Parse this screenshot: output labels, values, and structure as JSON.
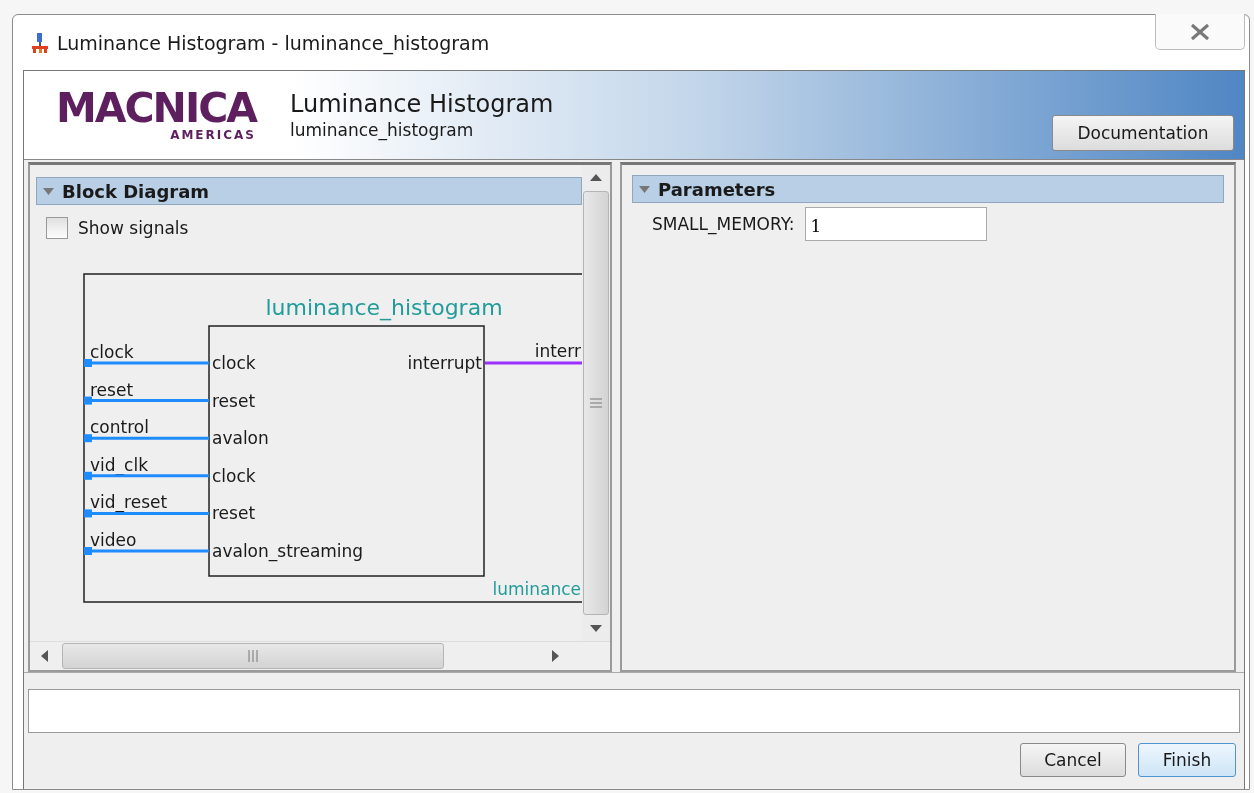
{
  "window": {
    "title": "Luminance Histogram - luminance_histogram"
  },
  "header": {
    "logo_main": "MACNICA",
    "logo_sub": "AMERICAS",
    "title": "Luminance Histogram",
    "subtitle": "luminance_histogram",
    "documentation_button": "Documentation"
  },
  "block_diagram": {
    "heading": "Block Diagram",
    "expanded": true,
    "show_signals": {
      "label": "Show signals",
      "checked": false
    },
    "diagram": {
      "title": "luminance_histogram",
      "footer_label": "luminance",
      "inputs": [
        {
          "external": "clock",
          "port": "clock"
        },
        {
          "external": "reset",
          "port": "reset"
        },
        {
          "external": "control",
          "port": "avalon"
        },
        {
          "external": "vid_clk",
          "port": "clock"
        },
        {
          "external": "vid_reset",
          "port": "reset"
        },
        {
          "external": "video",
          "port": "avalon_streaming"
        }
      ],
      "outputs": [
        {
          "port": "interrupt",
          "external": "interr"
        }
      ]
    }
  },
  "parameters": {
    "heading": "Parameters",
    "expanded": true,
    "fields": [
      {
        "label": "SMALL_MEMORY:",
        "value": "1"
      }
    ]
  },
  "buttons": [
    {
      "label": "Cancel",
      "selected": false
    },
    {
      "label": "Finish",
      "selected": true
    }
  ]
}
